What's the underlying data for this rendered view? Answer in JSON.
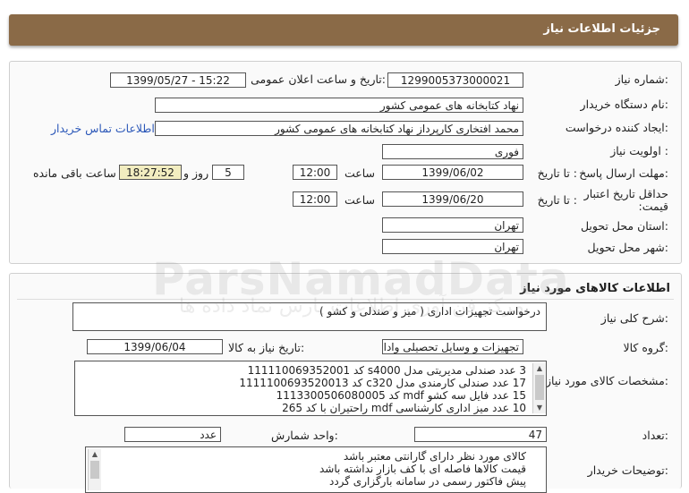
{
  "header": {
    "title": "جزئیات اطلاعات نیاز"
  },
  "need_info": {
    "need_number_label": "شماره نیاز:",
    "need_number": "1299005373000021",
    "announce_label": "تاریخ و ساعت اعلان عمومی:",
    "announce_value": "1399/05/27 - 15:22",
    "buyer_org_label": "نام دستگاه خریدار:",
    "buyer_org": "نهاد کتابخانه های عمومی کشور",
    "requester_label": "ایجاد کننده درخواست:",
    "requester": "محمد افتخاری کارپرداز نهاد کتابخانه های عمومی کشور",
    "contact_link": "اطلاعات تماس خریدار",
    "priority_label": "اولویت نیاز :",
    "priority": "فوری",
    "deadline_label": "مهلت ارسال پاسخ:",
    "until_date_label": "تا تاریخ :",
    "deadline_date": "1399/06/02",
    "time_label": "ساعت",
    "deadline_time": "12:00",
    "days": "5",
    "days_label": "روز و",
    "remaining": "18:27:52",
    "remaining_label": "ساعت باقی مانده",
    "validity_label": "حداقل تاریخ اعتبار قیمت:",
    "validity_date": "1399/06/20",
    "validity_time": "12:00",
    "province_label": "استان محل تحویل:",
    "province": "تهران",
    "city_label": "شهر محل تحویل:",
    "city": "تهران"
  },
  "goods": {
    "section_title": "اطلاعات کالاهای مورد نیاز",
    "desc_label": "شرح کلی نیاز:",
    "desc": "درخواست تجهیزات اداری ( میز و صندلی و کشو )",
    "group_label": "گروه کالا:",
    "group": "تجهیزات و وسایل تحصیلی واداری",
    "need_date_label": "تاریخ نیاز به کالا:",
    "need_date": "1399/06/04",
    "specs_label": "مشخصات کالای مورد نیاز:",
    "specs": [
      "3 عدد صندلی مدیریتی مدل s4000 کد 111110069352001",
      "17 عدد صندلی کارمندی مدل c320 کد 1111100693520013",
      "15 عدد فایل سه کشو mdf  کد 1113300506080005",
      "10 عدد میز اداری کارشناسی mdf  راحتیران با کد 265"
    ],
    "quantity_label": "تعداد:",
    "quantity": "47",
    "unit_label": "واحد شمارش:",
    "unit": "عدد",
    "buyer_notes_label": "توضیحات خریدار:",
    "buyer_notes": [
      "کالای مورد نظر دارای گارانتی معتبر  باشد",
      "قیمت کالاها فاصله ای با کف بازار نداشته باشد",
      "پیش فاکتور رسمی در سامانه بارگزاری گردد"
    ]
  },
  "watermark": {
    "text": "ParsNamadData",
    "sub": "مرکز فن آوری اطلاعات پارس نماد داده ها"
  }
}
